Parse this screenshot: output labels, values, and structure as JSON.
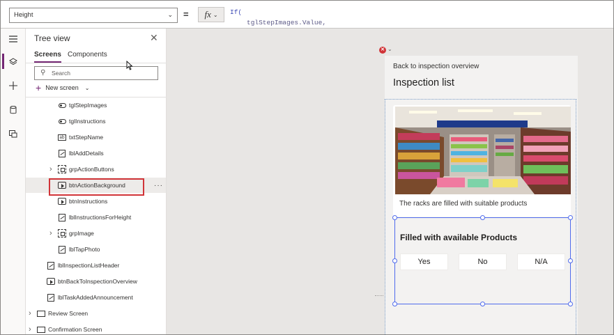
{
  "formula_bar": {
    "property": "Height",
    "equals": "=",
    "fx": "fx",
    "formula_line1": "If(",
    "formula_line2": "tglStepImages.Value,"
  },
  "rail": {
    "icons": [
      "hamburger-icon",
      "layers-icon",
      "plus-icon",
      "database-icon",
      "media-icon"
    ]
  },
  "tree_view": {
    "title": "Tree view",
    "tabs": [
      "Screens",
      "Components"
    ],
    "search_placeholder": "Search",
    "new_screen_label": "New screen",
    "nodes": [
      {
        "label": "tglStepImages",
        "icon": "toggle-icon"
      },
      {
        "label": "tglInstructions",
        "icon": "toggle-icon"
      },
      {
        "label": "txtStepName",
        "icon": "text-input-icon"
      },
      {
        "label": "lblAddDetails",
        "icon": "label-icon"
      },
      {
        "label": "grpActionButtons",
        "icon": "group-icon",
        "expandable": true
      },
      {
        "label": "btnActionBackground",
        "icon": "button-icon",
        "selected": true
      },
      {
        "label": "btnInstructions",
        "icon": "button-icon"
      },
      {
        "label": "lblInstructionsForHeight",
        "icon": "label-icon"
      },
      {
        "label": "grpImage",
        "icon": "group-icon",
        "expandable": true
      },
      {
        "label": "lblTapPhoto",
        "icon": "label-icon"
      },
      {
        "label": "lblInspectionListHeader",
        "icon": "label-icon"
      },
      {
        "label": "btnBackToInspectionOverview",
        "icon": "button-icon"
      },
      {
        "label": "lblTaskAddedAnnouncement",
        "icon": "label-icon"
      },
      {
        "label": "Review Screen",
        "icon": "screen-icon",
        "expandable": true
      },
      {
        "label": "Confirmation Screen",
        "icon": "screen-icon",
        "expandable": true
      }
    ],
    "more_label": "···"
  },
  "app_screen": {
    "back_link": "Back to inspection overview",
    "title": "Inspection list",
    "card_text": "The racks are filled with suitable products",
    "question_title": "Filled with available Products",
    "answers": [
      "Yes",
      "No",
      "N/A"
    ]
  },
  "colors": {
    "accent": "#742774",
    "selection_border": "#d13438",
    "handle_blue": "#4f6bed"
  }
}
